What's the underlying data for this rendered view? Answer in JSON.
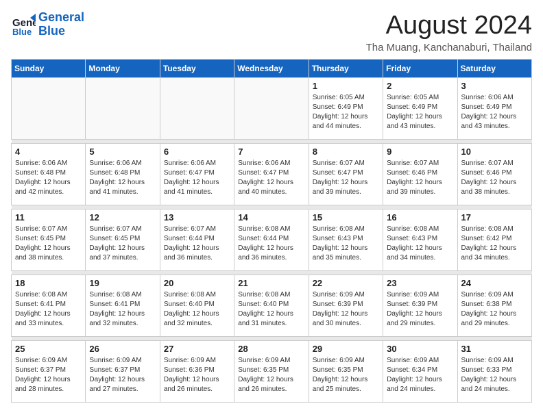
{
  "header": {
    "logo_line1": "General",
    "logo_line2": "Blue",
    "month": "August 2024",
    "location": "Tha Muang, Kanchanaburi, Thailand"
  },
  "days_of_week": [
    "Sunday",
    "Monday",
    "Tuesday",
    "Wednesday",
    "Thursday",
    "Friday",
    "Saturday"
  ],
  "weeks": [
    {
      "days": [
        {
          "number": "",
          "info": ""
        },
        {
          "number": "",
          "info": ""
        },
        {
          "number": "",
          "info": ""
        },
        {
          "number": "",
          "info": ""
        },
        {
          "number": "1",
          "info": "Sunrise: 6:05 AM\nSunset: 6:49 PM\nDaylight: 12 hours\nand 44 minutes."
        },
        {
          "number": "2",
          "info": "Sunrise: 6:05 AM\nSunset: 6:49 PM\nDaylight: 12 hours\nand 43 minutes."
        },
        {
          "number": "3",
          "info": "Sunrise: 6:06 AM\nSunset: 6:49 PM\nDaylight: 12 hours\nand 43 minutes."
        }
      ]
    },
    {
      "days": [
        {
          "number": "4",
          "info": "Sunrise: 6:06 AM\nSunset: 6:48 PM\nDaylight: 12 hours\nand 42 minutes."
        },
        {
          "number": "5",
          "info": "Sunrise: 6:06 AM\nSunset: 6:48 PM\nDaylight: 12 hours\nand 41 minutes."
        },
        {
          "number": "6",
          "info": "Sunrise: 6:06 AM\nSunset: 6:47 PM\nDaylight: 12 hours\nand 41 minutes."
        },
        {
          "number": "7",
          "info": "Sunrise: 6:06 AM\nSunset: 6:47 PM\nDaylight: 12 hours\nand 40 minutes."
        },
        {
          "number": "8",
          "info": "Sunrise: 6:07 AM\nSunset: 6:47 PM\nDaylight: 12 hours\nand 39 minutes."
        },
        {
          "number": "9",
          "info": "Sunrise: 6:07 AM\nSunset: 6:46 PM\nDaylight: 12 hours\nand 39 minutes."
        },
        {
          "number": "10",
          "info": "Sunrise: 6:07 AM\nSunset: 6:46 PM\nDaylight: 12 hours\nand 38 minutes."
        }
      ]
    },
    {
      "days": [
        {
          "number": "11",
          "info": "Sunrise: 6:07 AM\nSunset: 6:45 PM\nDaylight: 12 hours\nand 38 minutes."
        },
        {
          "number": "12",
          "info": "Sunrise: 6:07 AM\nSunset: 6:45 PM\nDaylight: 12 hours\nand 37 minutes."
        },
        {
          "number": "13",
          "info": "Sunrise: 6:07 AM\nSunset: 6:44 PM\nDaylight: 12 hours\nand 36 minutes."
        },
        {
          "number": "14",
          "info": "Sunrise: 6:08 AM\nSunset: 6:44 PM\nDaylight: 12 hours\nand 36 minutes."
        },
        {
          "number": "15",
          "info": "Sunrise: 6:08 AM\nSunset: 6:43 PM\nDaylight: 12 hours\nand 35 minutes."
        },
        {
          "number": "16",
          "info": "Sunrise: 6:08 AM\nSunset: 6:43 PM\nDaylight: 12 hours\nand 34 minutes."
        },
        {
          "number": "17",
          "info": "Sunrise: 6:08 AM\nSunset: 6:42 PM\nDaylight: 12 hours\nand 34 minutes."
        }
      ]
    },
    {
      "days": [
        {
          "number": "18",
          "info": "Sunrise: 6:08 AM\nSunset: 6:41 PM\nDaylight: 12 hours\nand 33 minutes."
        },
        {
          "number": "19",
          "info": "Sunrise: 6:08 AM\nSunset: 6:41 PM\nDaylight: 12 hours\nand 32 minutes."
        },
        {
          "number": "20",
          "info": "Sunrise: 6:08 AM\nSunset: 6:40 PM\nDaylight: 12 hours\nand 32 minutes."
        },
        {
          "number": "21",
          "info": "Sunrise: 6:08 AM\nSunset: 6:40 PM\nDaylight: 12 hours\nand 31 minutes."
        },
        {
          "number": "22",
          "info": "Sunrise: 6:09 AM\nSunset: 6:39 PM\nDaylight: 12 hours\nand 30 minutes."
        },
        {
          "number": "23",
          "info": "Sunrise: 6:09 AM\nSunset: 6:39 PM\nDaylight: 12 hours\nand 29 minutes."
        },
        {
          "number": "24",
          "info": "Sunrise: 6:09 AM\nSunset: 6:38 PM\nDaylight: 12 hours\nand 29 minutes."
        }
      ]
    },
    {
      "days": [
        {
          "number": "25",
          "info": "Sunrise: 6:09 AM\nSunset: 6:37 PM\nDaylight: 12 hours\nand 28 minutes."
        },
        {
          "number": "26",
          "info": "Sunrise: 6:09 AM\nSunset: 6:37 PM\nDaylight: 12 hours\nand 27 minutes."
        },
        {
          "number": "27",
          "info": "Sunrise: 6:09 AM\nSunset: 6:36 PM\nDaylight: 12 hours\nand 26 minutes."
        },
        {
          "number": "28",
          "info": "Sunrise: 6:09 AM\nSunset: 6:35 PM\nDaylight: 12 hours\nand 26 minutes."
        },
        {
          "number": "29",
          "info": "Sunrise: 6:09 AM\nSunset: 6:35 PM\nDaylight: 12 hours\nand 25 minutes."
        },
        {
          "number": "30",
          "info": "Sunrise: 6:09 AM\nSunset: 6:34 PM\nDaylight: 12 hours\nand 24 minutes."
        },
        {
          "number": "31",
          "info": "Sunrise: 6:09 AM\nSunset: 6:33 PM\nDaylight: 12 hours\nand 24 minutes."
        }
      ]
    }
  ]
}
